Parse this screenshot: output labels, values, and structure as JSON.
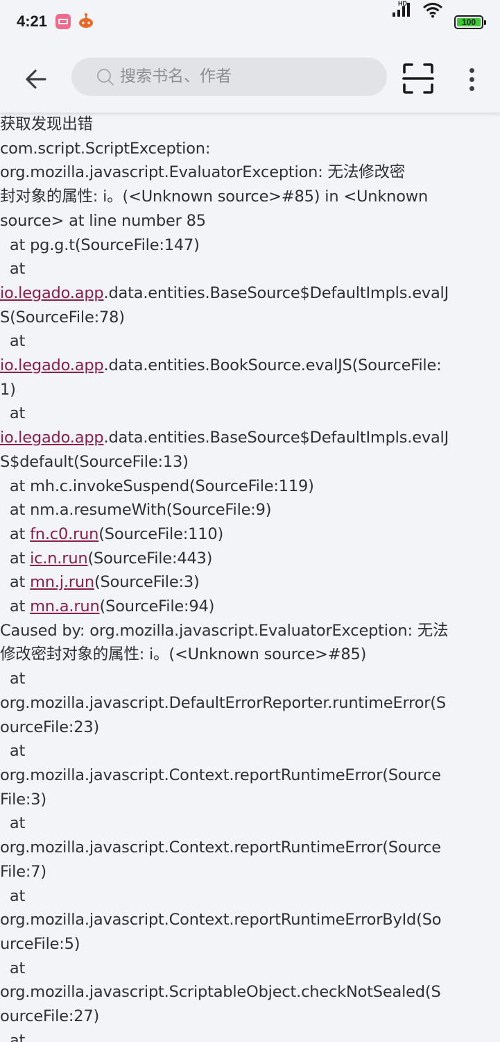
{
  "status_bar": {
    "time": "4:21",
    "network": "HD",
    "battery": "100"
  },
  "toolbar": {
    "search_placeholder": "搜索书名、作者"
  },
  "log_lines": [
    [
      {
        "t": "获取发现出错"
      }
    ],
    [
      {
        "t": "com.script.ScriptException:"
      }
    ],
    [
      {
        "t": "org.mozilla.javascript.EvaluatorException: 无法修改密"
      }
    ],
    [
      {
        "t": "封对象的属性: i。(<Unknown source>#85) in <Unknown"
      }
    ],
    [
      {
        "t": "source> at line number 85"
      }
    ],
    [
      {
        "t": "  at pg.g.t(SourceFile:147)"
      }
    ],
    [
      {
        "t": "  at"
      }
    ],
    [
      {
        "t": "io.legado.app",
        "link": true
      },
      {
        "t": ".data.entities.BaseSource$DefaultImpls.evalJ"
      }
    ],
    [
      {
        "t": "S(SourceFile:78)"
      }
    ],
    [
      {
        "t": "  at"
      }
    ],
    [
      {
        "t": "io.legado.app",
        "link": true
      },
      {
        "t": ".data.entities.BookSource.evalJS(SourceFile:"
      }
    ],
    [
      {
        "t": "1)"
      }
    ],
    [
      {
        "t": "  at"
      }
    ],
    [
      {
        "t": "io.legado.app",
        "link": true
      },
      {
        "t": ".data.entities.BaseSource$DefaultImpls.evalJ"
      }
    ],
    [
      {
        "t": "S$default(SourceFile:13)"
      }
    ],
    [
      {
        "t": "  at mh.c.invokeSuspend(SourceFile:119)"
      }
    ],
    [
      {
        "t": "  at nm.a.resumeWith(SourceFile:9)"
      }
    ],
    [
      {
        "t": "  at "
      },
      {
        "t": "fn.c0.run",
        "link": true
      },
      {
        "t": "(SourceFile:110)"
      }
    ],
    [
      {
        "t": "  at "
      },
      {
        "t": "ic.n.run",
        "link": true
      },
      {
        "t": "(SourceFile:443)"
      }
    ],
    [
      {
        "t": "  at "
      },
      {
        "t": "mn.j.run",
        "link": true
      },
      {
        "t": "(SourceFile:3)"
      }
    ],
    [
      {
        "t": "  at "
      },
      {
        "t": "mn.a.run",
        "link": true
      },
      {
        "t": "(SourceFile:94)"
      }
    ],
    [
      {
        "t": "Caused by: org.mozilla.javascript.EvaluatorException: 无法"
      }
    ],
    [
      {
        "t": "修改密封对象的属性: i。(<Unknown source>#85)"
      }
    ],
    [
      {
        "t": "  at"
      }
    ],
    [
      {
        "t": "org.mozilla.javascript.DefaultErrorReporter.runtimeError(S"
      }
    ],
    [
      {
        "t": "ourceFile:23)"
      }
    ],
    [
      {
        "t": "  at"
      }
    ],
    [
      {
        "t": "org.mozilla.javascript.Context.reportRuntimeError(Source"
      }
    ],
    [
      {
        "t": "File:3)"
      }
    ],
    [
      {
        "t": "  at"
      }
    ],
    [
      {
        "t": "org.mozilla.javascript.Context.reportRuntimeError(Source"
      }
    ],
    [
      {
        "t": "File:7)"
      }
    ],
    [
      {
        "t": "  at"
      }
    ],
    [
      {
        "t": "org.mozilla.javascript.Context.reportRuntimeErrorById(So"
      }
    ],
    [
      {
        "t": "urceFile:5)"
      }
    ],
    [
      {
        "t": "  at"
      }
    ],
    [
      {
        "t": "org.mozilla.javascript.ScriptableObject.checkNotSealed(S"
      }
    ],
    [
      {
        "t": "ourceFile:27)"
      }
    ],
    [
      {
        "t": "  at"
      }
    ]
  ]
}
